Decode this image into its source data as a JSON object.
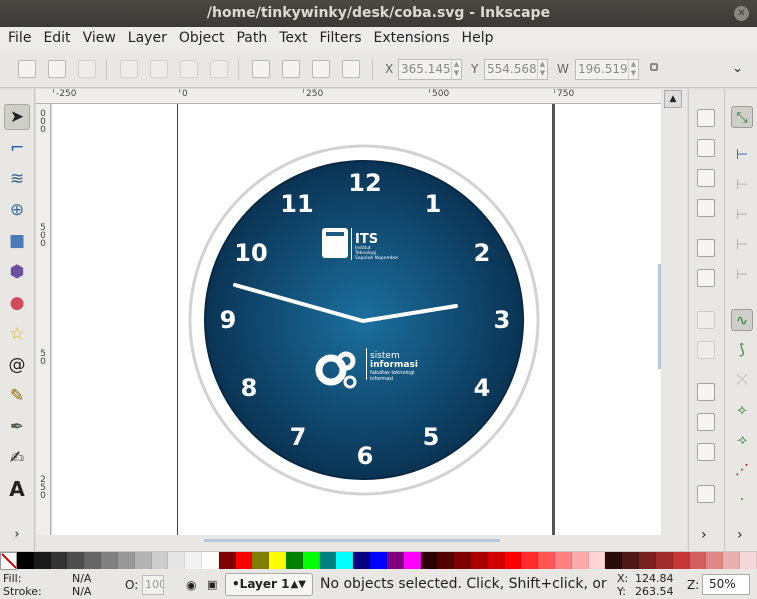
{
  "window": {
    "title": "/home/tinkywinky/desk/coba.svg - Inkscape"
  },
  "menu": [
    "File",
    "Edit",
    "View",
    "Layer",
    "Object",
    "Path",
    "Text",
    "Filters",
    "Extensions",
    "Help"
  ],
  "toolbar": {
    "x_label": "X",
    "x_value": "365.145",
    "y_label": "Y",
    "y_value": "554.568",
    "w_label": "W",
    "w_value": "196.519"
  },
  "rulers": {
    "h_labels": [
      "-250",
      "0",
      "250",
      "500",
      "750"
    ],
    "v_labels": [
      "0",
      "0",
      "0",
      "5",
      "0",
      "0",
      "5",
      "0",
      "2",
      "5",
      "0"
    ]
  },
  "clock": {
    "numbers": [
      "12",
      "1",
      "2",
      "3",
      "4",
      "5",
      "6",
      "7",
      "8",
      "9",
      "10",
      "11"
    ],
    "its_logo": {
      "main": "ITS",
      "line1": "Institut",
      "line2": "Teknologi",
      "line3": "Sepuluh Nopember"
    },
    "si_logo": {
      "line1": "sistem",
      "line2": "informasi",
      "line3": "fakultas teknologi",
      "line4": "informasi"
    },
    "colors": {
      "face_center": "#1c6f9e",
      "face_edge": "#0a3354",
      "rim": "#d2d2d2",
      "hands": "#ffffff"
    }
  },
  "palette": [
    "#000000",
    "#1a1a1a",
    "#333333",
    "#4d4d4d",
    "#666666",
    "#808080",
    "#999999",
    "#b3b3b3",
    "#cccccc",
    "#e6e6e6",
    "#f2f2f2",
    "#ffffff",
    "#800000",
    "#ff0000",
    "#808000",
    "#ffff00",
    "#008000",
    "#00ff00",
    "#008080",
    "#00ffff",
    "#000080",
    "#0000ff",
    "#800080",
    "#ff00ff",
    "#2b0000",
    "#550000",
    "#800000",
    "#aa0000",
    "#d40000",
    "#ff0000",
    "#ff2a2a",
    "#ff5555",
    "#ff8080",
    "#ffaaaa",
    "#ffd5d5",
    "#280b0b",
    "#501616",
    "#782121",
    "#a02c2c",
    "#c83737",
    "#d35f5f",
    "#de8787",
    "#e9afaf",
    "#f4d7d7"
  ],
  "status": {
    "fill_label": "Fill:",
    "fill_value": "N/A",
    "stroke_label": "Stroke:",
    "stroke_value": "N/A",
    "opacity_label": "O:",
    "opacity_value": "100",
    "layer": "•Layer 1",
    "message": "No objects selected. Click, Shift+click, or drag around objects to select.",
    "x_label": "X:",
    "x_value": "124.84",
    "y_label": "Y:",
    "y_value": "263.54",
    "zoom_label": "Z:",
    "zoom_value": "50%"
  }
}
